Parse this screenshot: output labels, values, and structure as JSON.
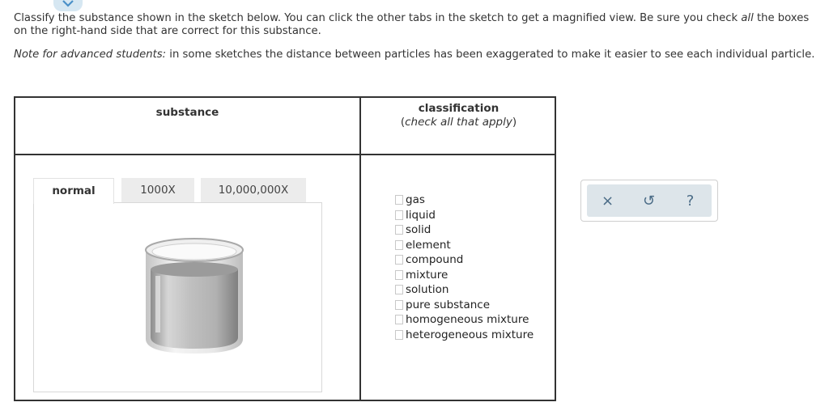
{
  "instructions": {
    "line1_pre": "Classify the substance shown in the sketch below. You can click the other tabs in the sketch to get a magnified view. Be sure you check ",
    "line1_em": "all",
    "line1_post": " the boxes on the right-hand side that are correct for this substance.",
    "note_em": "Note for advanced students:",
    "note_text": " in some sketches the distance between particles has been exaggerated to make it easier to see each individual particle."
  },
  "table": {
    "substance_header": "substance",
    "classification_header": "classification",
    "classification_sub_open": "(",
    "classification_sub_em": "check all that apply",
    "classification_sub_close": ")"
  },
  "tabs": [
    {
      "label": "normal",
      "selected": true
    },
    {
      "label": "1000X",
      "selected": false
    },
    {
      "label": "10,000,000X",
      "selected": false
    }
  ],
  "options": [
    {
      "label": "gas",
      "checked": false
    },
    {
      "label": "liquid",
      "checked": false
    },
    {
      "label": "solid",
      "checked": false
    },
    {
      "label": "element",
      "checked": false
    },
    {
      "label": "compound",
      "checked": false
    },
    {
      "label": "mixture",
      "checked": false
    },
    {
      "label": "solution",
      "checked": false
    },
    {
      "label": "pure substance",
      "checked": false
    },
    {
      "label": "homogeneous mixture",
      "checked": false
    },
    {
      "label": "heterogeneous mixture",
      "checked": false
    }
  ],
  "actions": [
    {
      "icon": "close-icon",
      "glyph": "×"
    },
    {
      "icon": "undo-icon",
      "glyph": "↺"
    },
    {
      "icon": "help-icon",
      "glyph": "?"
    }
  ],
  "colors": {
    "accent": "#4a6b86",
    "action_bg": "#dde5ea",
    "tab_inactive": "#ececec"
  }
}
